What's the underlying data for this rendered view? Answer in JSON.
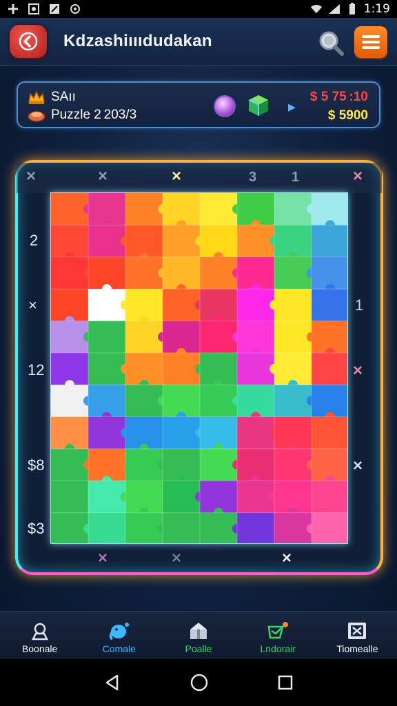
{
  "status_bar": {
    "time": "1:19"
  },
  "header": {
    "title": "Kdzashiıııdudakan"
  },
  "info": {
    "player_name": "SAıı",
    "puzzle_label": "Puzzle 2 203/3",
    "stat_top": "$ 5 75 :10",
    "stat_bottom": "$ 5900"
  },
  "board": {
    "top_marks": [
      "×",
      "×",
      "×",
      "3",
      "1",
      "×"
    ],
    "left_labels": [
      "2",
      "×",
      "12",
      "$8",
      "$3"
    ],
    "right_labels": [
      "1",
      "×",
      "×"
    ],
    "bottom_marks": [
      "×",
      "×",
      "×"
    ]
  },
  "nav": [
    {
      "label": "Boonale",
      "icon": "home-icon",
      "color": "#ffffff"
    },
    {
      "label": "Comale",
      "icon": "elephant-icon",
      "color": "#3fb7ff"
    },
    {
      "label": "Poalle",
      "icon": "gift-icon",
      "color": "#38d66b"
    },
    {
      "label": "Lndorair",
      "icon": "trophy-icon",
      "color": "#38d66b"
    },
    {
      "label": "Tiomealle",
      "icon": "box-icon",
      "color": "#ffffff"
    }
  ],
  "colors": {
    "accent_orange": "#ff7a1a",
    "accent_red": "#d32a28",
    "frame_glow": "#ffb23a",
    "frame_cyan": "#39f0ff",
    "frame_pink": "#ff5ad8"
  }
}
